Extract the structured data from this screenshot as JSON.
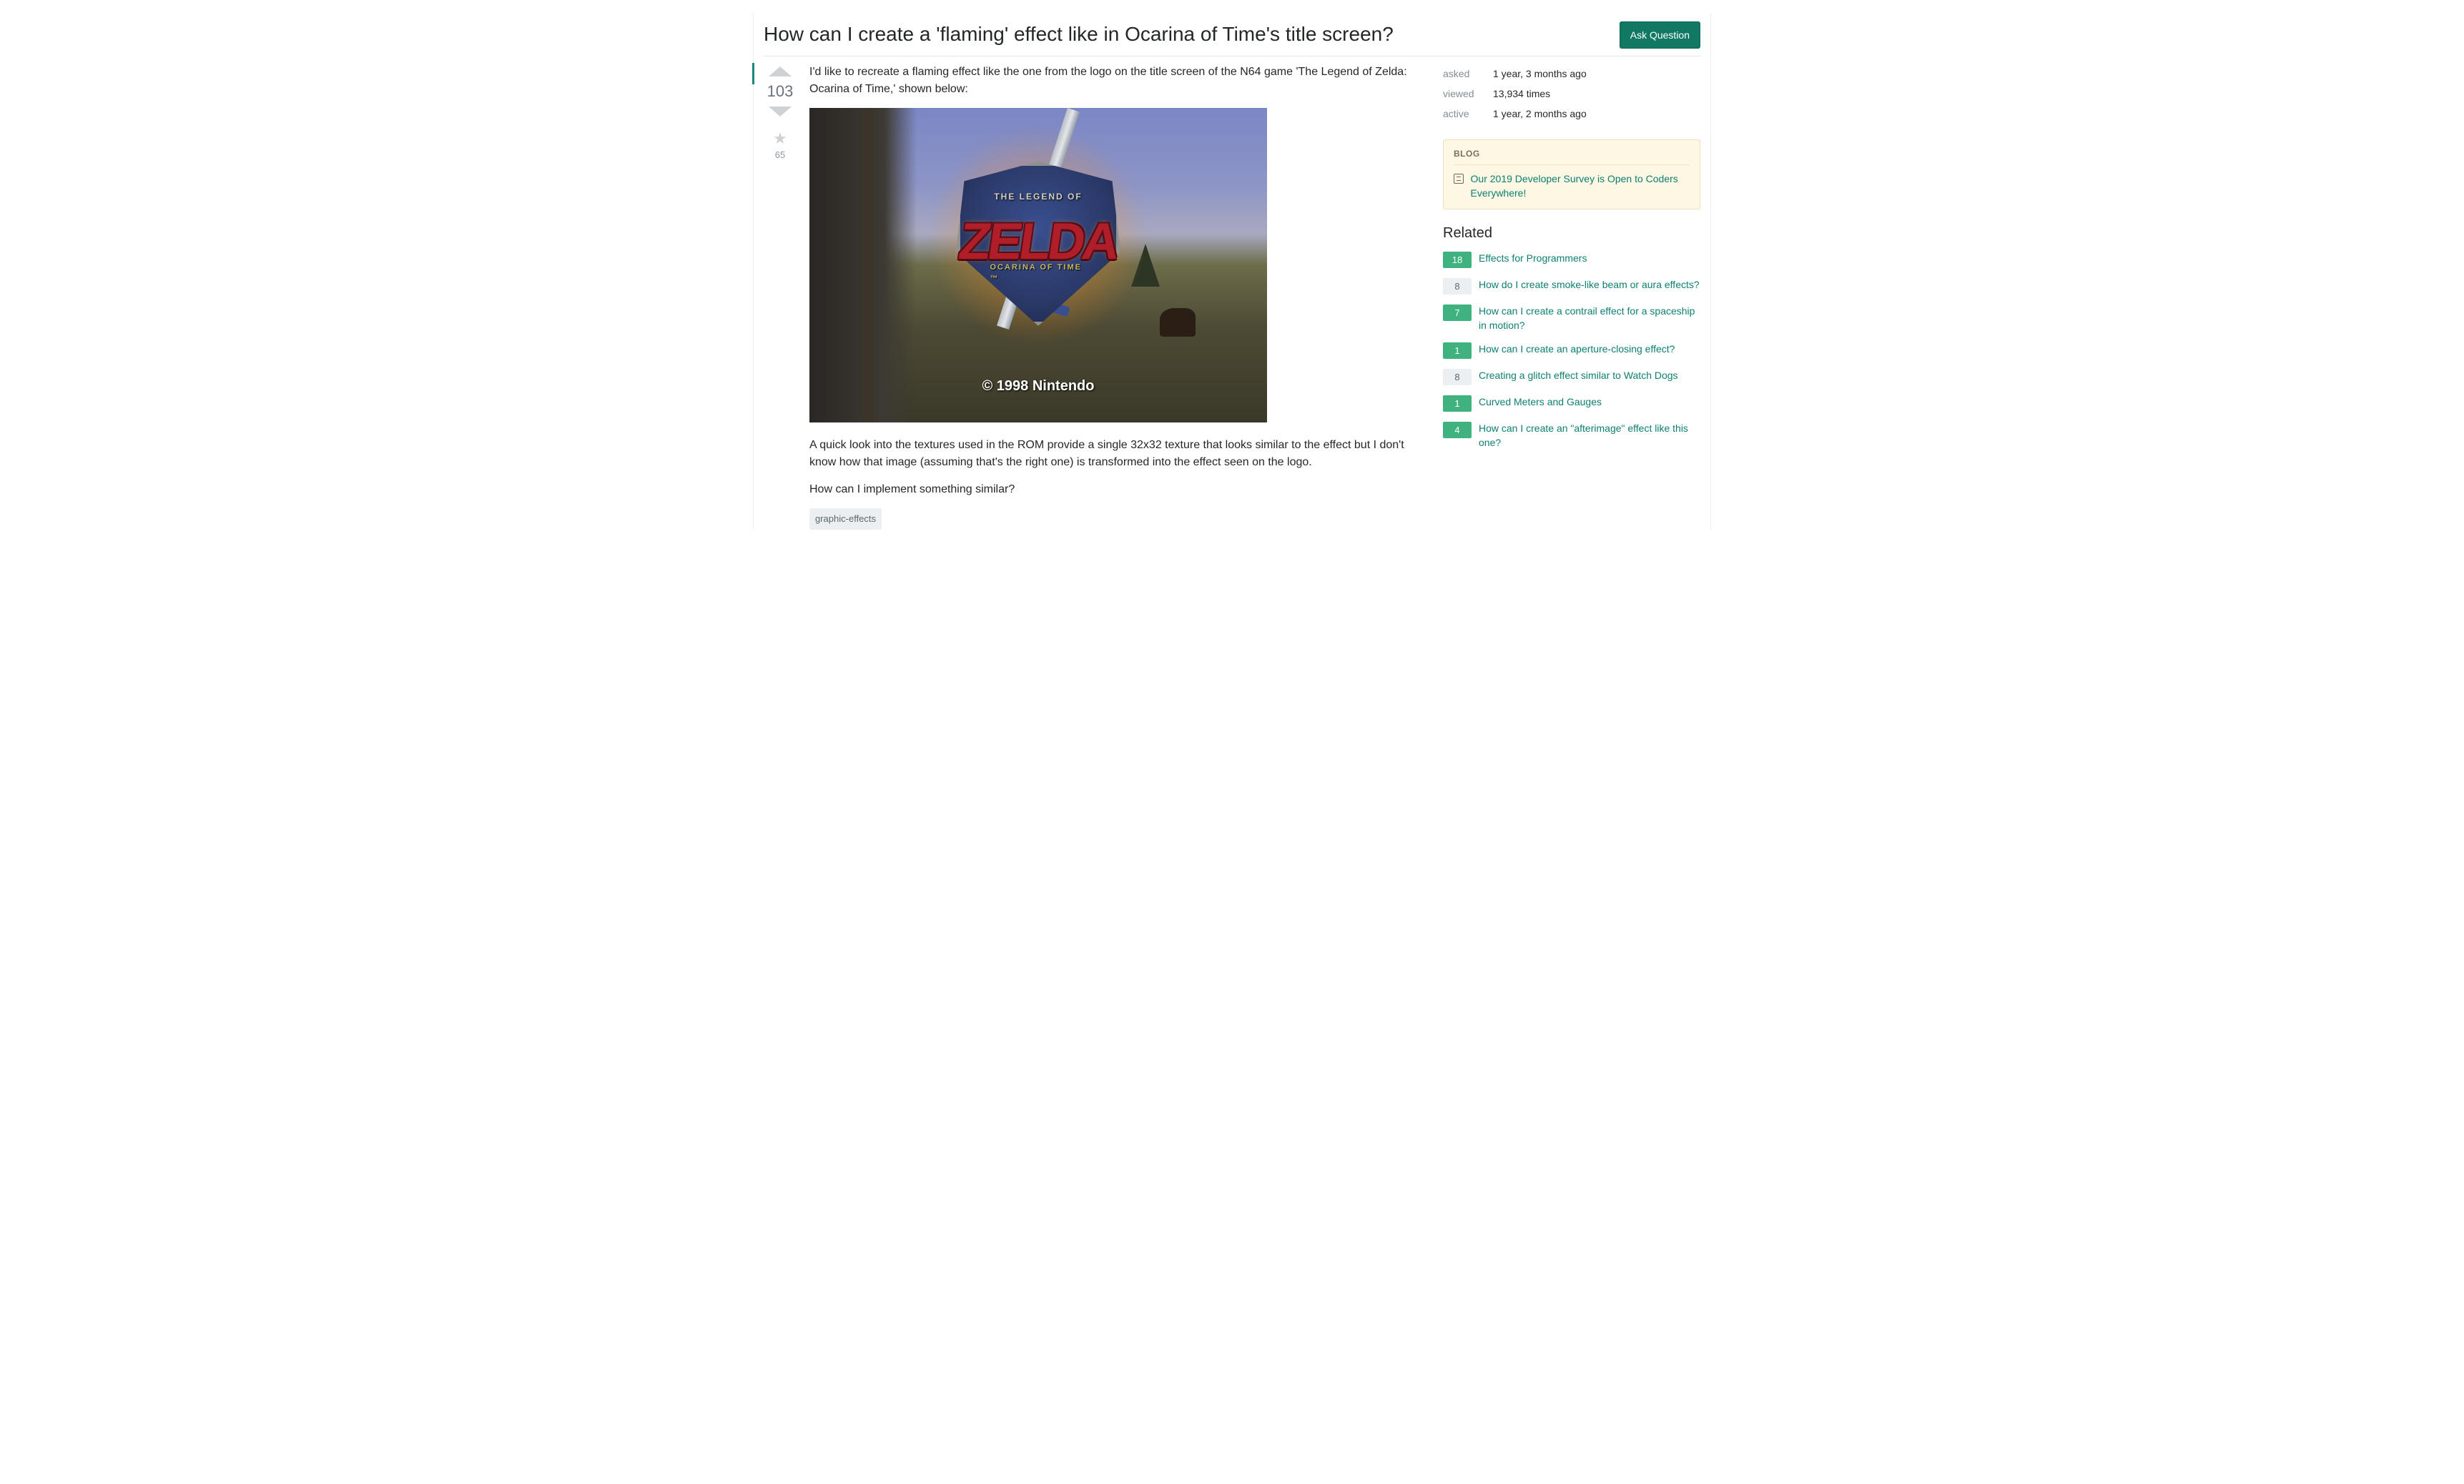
{
  "question": {
    "title": "How can I create a 'flaming' effect like in Ocarina of Time's title screen?",
    "ask_button": "Ask Question",
    "body_intro": "I'd like to recreate a flaming effect like the one from the logo on the title screen of the N64 game 'The Legend of Zelda: Ocarina of Time,' shown below:",
    "body_mid": "A quick look into the textures used in the ROM provide a single 32x32 texture that looks similar to the effect but I don't know how that image (assuming that's the right one) is transformed into the effect seen on the logo.",
    "body_end": "How can I implement something similar?",
    "tags": [
      "graphic-effects"
    ],
    "votes": "103",
    "favorites": "65",
    "image": {
      "logo_top": "THE LEGEND OF",
      "logo_main": "ZELDA",
      "logo_sub": "OCARINA OF TIME ™",
      "registered": "®",
      "copyright": "© 1998 Nintendo"
    }
  },
  "stats": {
    "asked_label": "asked",
    "asked_value": "1 year, 3 months ago",
    "viewed_label": "viewed",
    "viewed_value": "13,934 times",
    "active_label": "active",
    "active_value": "1 year, 2 months ago"
  },
  "blog": {
    "heading": "BLOG",
    "item": "Our 2019 Developer Survey is Open to Coders Everywhere!"
  },
  "related": {
    "heading": "Related",
    "items": [
      {
        "score": "18",
        "answered": true,
        "title": "Effects for Programmers"
      },
      {
        "score": "8",
        "answered": false,
        "title": "How do I create smoke-like beam or aura effects?"
      },
      {
        "score": "7",
        "answered": true,
        "title": "How can I create a contrail effect for a spaceship in motion?"
      },
      {
        "score": "1",
        "answered": true,
        "title": "How can I create an aperture-closing effect?"
      },
      {
        "score": "8",
        "answered": false,
        "title": "Creating a glitch effect similar to Watch Dogs"
      },
      {
        "score": "1",
        "answered": true,
        "title": "Curved Meters and Gauges"
      },
      {
        "score": "4",
        "answered": true,
        "title": "How can I create an \"afterimage\" effect like this one?"
      }
    ]
  }
}
